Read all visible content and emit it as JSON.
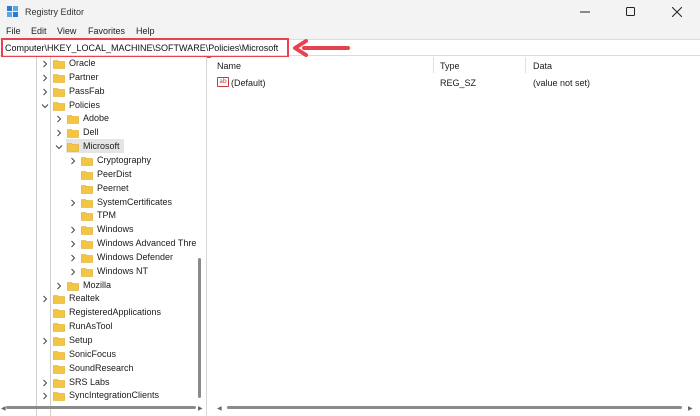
{
  "window": {
    "title": "Registry Editor",
    "minimize_icon": "minimize-icon",
    "maximize_icon": "maximize-icon",
    "close_icon": "close-icon"
  },
  "menu": [
    "File",
    "Edit",
    "View",
    "Favorites",
    "Help"
  ],
  "address": {
    "path": "Computer\\HKEY_LOCAL_MACHINE\\SOFTWARE\\Policies\\Microsoft"
  },
  "colors": {
    "annotation_red": "#e8424f",
    "folder_yellow": "#f4c542",
    "selection": "#e5e5e5"
  },
  "tree": {
    "items": [
      {
        "label": "Oracle",
        "expander": "collapsed"
      },
      {
        "label": "Partner",
        "expander": "collapsed"
      },
      {
        "label": "PassFab",
        "expander": "collapsed"
      },
      {
        "label": "Policies",
        "expander": "expanded"
      },
      {
        "label": "Adobe",
        "expander": "collapsed"
      },
      {
        "label": "Dell",
        "expander": "collapsed"
      },
      {
        "label": "Microsoft",
        "expander": "expanded",
        "selected": true
      },
      {
        "label": "Cryptography",
        "expander": "collapsed"
      },
      {
        "label": "PeerDist",
        "expander": "none"
      },
      {
        "label": "Peernet",
        "expander": "none"
      },
      {
        "label": "SystemCertificates",
        "expander": "collapsed"
      },
      {
        "label": "TPM",
        "expander": "none"
      },
      {
        "label": "Windows",
        "expander": "collapsed"
      },
      {
        "label": "Windows Advanced Thre",
        "expander": "collapsed"
      },
      {
        "label": "Windows Defender",
        "expander": "collapsed"
      },
      {
        "label": "Windows NT",
        "expander": "collapsed"
      },
      {
        "label": "Mozilla",
        "expander": "collapsed"
      },
      {
        "label": "Realtek",
        "expander": "collapsed"
      },
      {
        "label": "RegisteredApplications",
        "expander": "none"
      },
      {
        "label": "RunAsTool",
        "expander": "none"
      },
      {
        "label": "Setup",
        "expander": "collapsed"
      },
      {
        "label": "SonicFocus",
        "expander": "none"
      },
      {
        "label": "SoundResearch",
        "expander": "none"
      },
      {
        "label": "SRS Labs",
        "expander": "collapsed"
      },
      {
        "label": "SyncIntegrationClients",
        "expander": "collapsed"
      }
    ]
  },
  "list": {
    "columns": [
      "Name",
      "Type",
      "Data"
    ],
    "rows": [
      {
        "icon": "string-value-icon",
        "icon_text": "ab",
        "name": "(Default)",
        "type": "REG_SZ",
        "data": "(value not set)"
      }
    ]
  }
}
